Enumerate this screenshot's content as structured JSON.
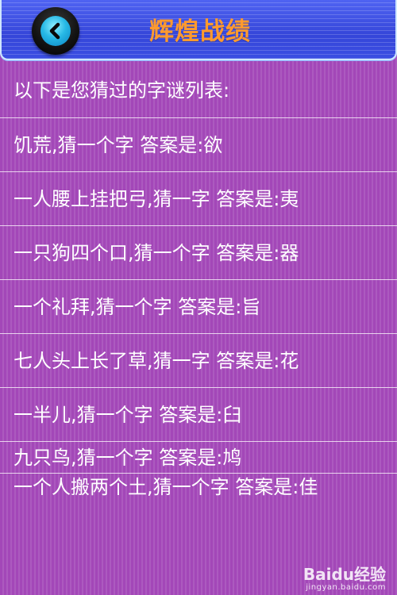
{
  "header": {
    "title": "辉煌战绩",
    "back_icon": "chevron-left-icon"
  },
  "intro": "以下是您猜过的字谜列表:",
  "riddles": [
    {
      "text": "饥荒,猜一个字 答案是:欲"
    },
    {
      "text": "一人腰上挂把弓,猜一字 答案是:夷"
    },
    {
      "text": "一只狗四个口,猜一个字 答案是:器"
    },
    {
      "text": "一个礼拜,猜一个字 答案是:旨"
    },
    {
      "text": "七人头上长了草,猜一字 答案是:花"
    },
    {
      "text": "一半儿,猜一个字 答案是:臼"
    },
    {
      "text": "九只鸟,猜一个字 答案是:鸠"
    },
    {
      "text": "一个人搬两个土,猜一个字 答案是:佳"
    }
  ],
  "watermark": {
    "brand": "Baidu经验",
    "url": "jingyan.baidu.com"
  },
  "colors": {
    "background": "#a347b8",
    "header": "#3d4fe6",
    "title": "#ff9a2e",
    "back_button": "#27b9e6"
  }
}
